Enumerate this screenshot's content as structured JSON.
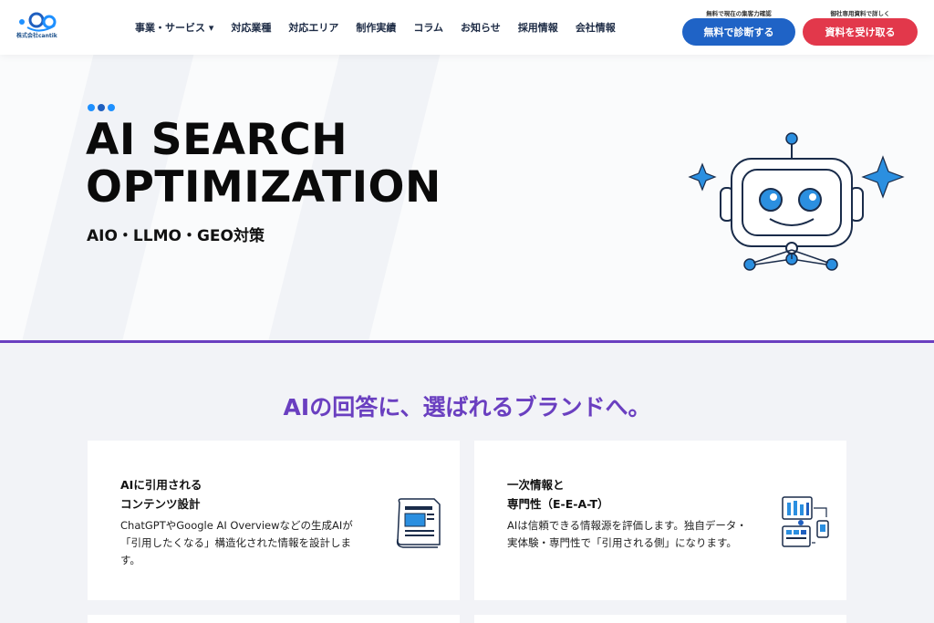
{
  "brand": {
    "logo_text": "株式会社cantik"
  },
  "nav": {
    "items": [
      "事業・サービス ▾",
      "対応業種",
      "対応エリア",
      "制作実績",
      "コラム",
      "お知らせ",
      "採用情報",
      "会社情報"
    ]
  },
  "header_cta": {
    "blue_sub": "無料で現在の集客力確認",
    "blue_label": "無料で診断する",
    "red_sub": "御社専用資料で詳しく",
    "red_label": "資料を受け取る",
    "blue_color": "#1f63c6",
    "red_color": "#e2384b"
  },
  "hero": {
    "title_line1": "AI SEARCH",
    "title_line2": "OPTIMIZATION",
    "subtitle": "AIO・LLMO・GEO対策",
    "illustration": "robot-illustration"
  },
  "section": {
    "headline": "AIの回答に、選ばれるブランドへ。",
    "accent_color": "#6a3fc0"
  },
  "cards": [
    {
      "title_line1": "AIに引用される",
      "title_line2": "コンテンツ設計",
      "text": "ChatGPTやGoogle AI Overviewなどの生成AIが「引用したくなる」構造化された情報を設計します。",
      "icon": "document-icon"
    },
    {
      "title_line1": "一次情報と",
      "title_line2": "専門性（E-E-A-T）",
      "text": "AIは信頼できる情報源を評価します。独自データ・実体験・専門性で「引用される側」になります。",
      "icon": "data-dashboard-icon"
    }
  ]
}
